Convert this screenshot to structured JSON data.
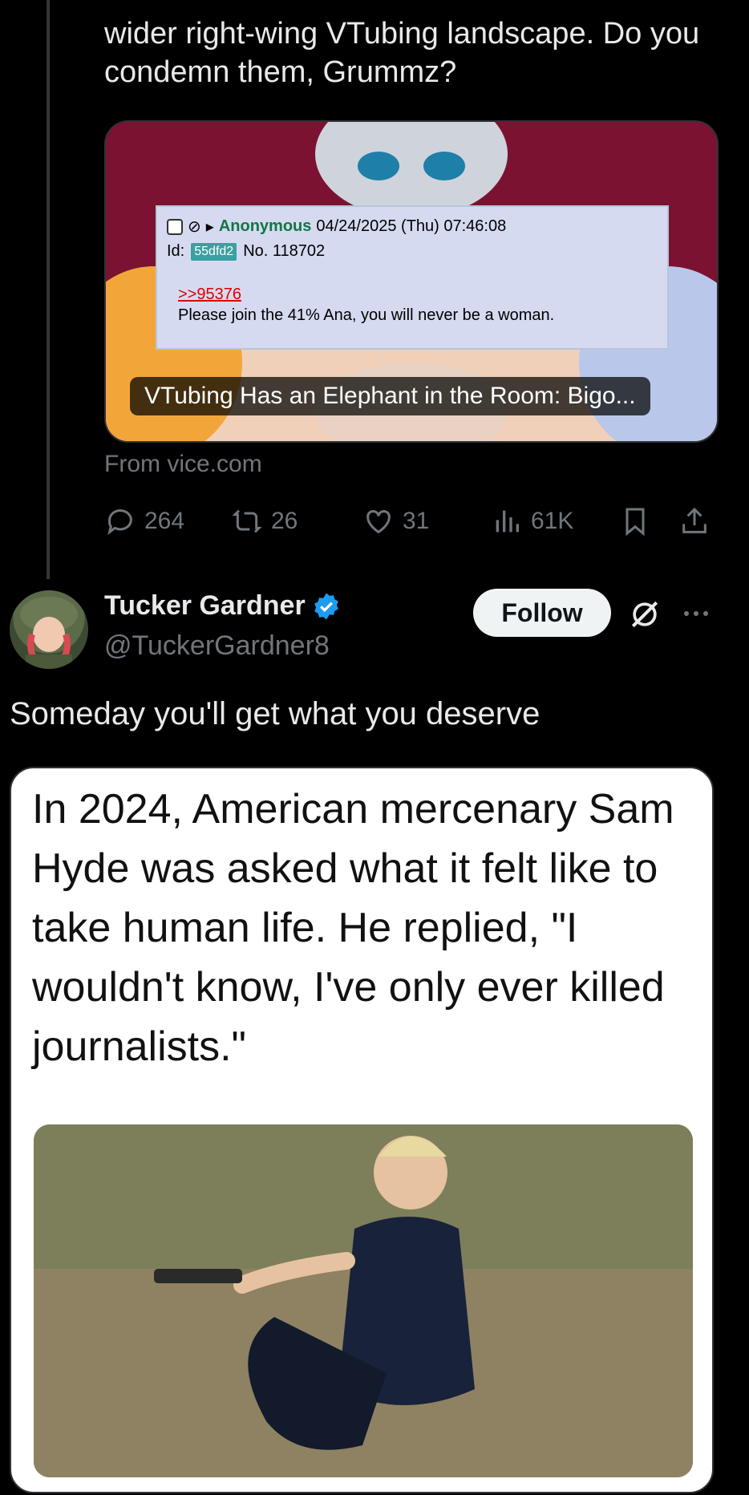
{
  "quoted_tweet": {
    "text": "wider right-wing VTubing landscape. Do you condemn them, Grummz?",
    "card": {
      "post": {
        "name": "Anonymous",
        "datetime": "04/24/2025 (Thu) 07:46:08",
        "id_label": "Id:",
        "id_value": "55dfd2",
        "number": "No. 118702",
        "quote_link": ">>95376",
        "message": "Please join the 41% Ana, you will never be a woman."
      },
      "title": "VTubing Has an Elephant in the Room: Bigo..."
    },
    "source": "From vice.com",
    "actions": {
      "replies": "264",
      "reposts": "26",
      "likes": "31",
      "views": "61K"
    }
  },
  "reply_tweet": {
    "display_name": "Tucker Gardner",
    "handle": "@TuckerGardner8",
    "follow_label": "Follow",
    "text": "Someday you'll get what you deserve",
    "media_text": "In 2024, American mercenary Sam Hyde was asked what it felt like to take human life. He replied, \"I wouldn't know, I've only ever killed journalists.\""
  },
  "colors": {
    "background": "#000000",
    "text_primary": "#e7e9ea",
    "text_secondary": "#71767b",
    "verified_blue": "#1d9bf0",
    "follow_bg": "#eff3f4"
  }
}
